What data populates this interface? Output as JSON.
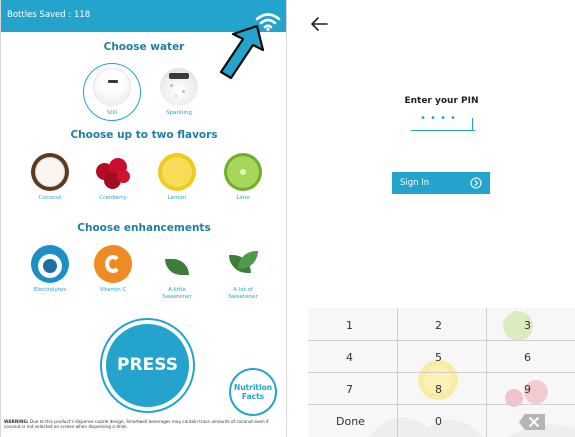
{
  "left_screen": {
    "status": {
      "bottles_saved": "Bottles Saved : 118"
    },
    "water": {
      "heading": "Choose water",
      "options": [
        {
          "label": "Still",
          "icon": "still-water-icon",
          "selected": true
        },
        {
          "label": "Sparkling",
          "icon": "sparkling-water-icon",
          "selected": false
        }
      ]
    },
    "flavors": {
      "heading": "Choose up to two flavors",
      "options": [
        {
          "label": "Coconut",
          "icon": "coconut-icon"
        },
        {
          "label": "Cranberry",
          "icon": "cranberry-icon"
        },
        {
          "label": "Lemon",
          "icon": "lemon-icon"
        },
        {
          "label": "Lime",
          "icon": "lime-icon"
        }
      ]
    },
    "enhancements": {
      "heading": "Choose enhancements",
      "options": [
        {
          "label": "Electrolytes",
          "icon": "electrolytes-icon"
        },
        {
          "label": "Vitamin C",
          "icon": "vitamin-c-icon"
        },
        {
          "label": "A little Sweetener",
          "icon": "little-sweetener-icon"
        },
        {
          "label": "A lot of Sweetener",
          "icon": "lot-sweetener-icon"
        }
      ]
    },
    "press_label": "PRESS",
    "nutrition_label": "Nutrition Facts",
    "warning_bold": "WARNING:",
    "warning_text": "Due to this product's dispense nozzle design, Smartwell beverages may contain trace amounts of coconut even if coconut is not selected on screen when dispensing a drink."
  },
  "right_screen": {
    "title": "Enter your PIN",
    "pin_value": "••••",
    "signin_label": "Sign In",
    "keypad": [
      [
        "1",
        "2",
        "3"
      ],
      [
        "4",
        "5",
        "6"
      ],
      [
        "7",
        "8",
        "9"
      ],
      [
        "Done",
        "0",
        "backspace"
      ]
    ]
  },
  "colors": {
    "accent": "#24a4cd",
    "heading": "#1f7ea4",
    "cranberry": "#c8102e",
    "lemon": "#f3c91c",
    "lime": "#86c540",
    "vitamin_c": "#f08a24",
    "sweetener": "#3d7f3a"
  }
}
